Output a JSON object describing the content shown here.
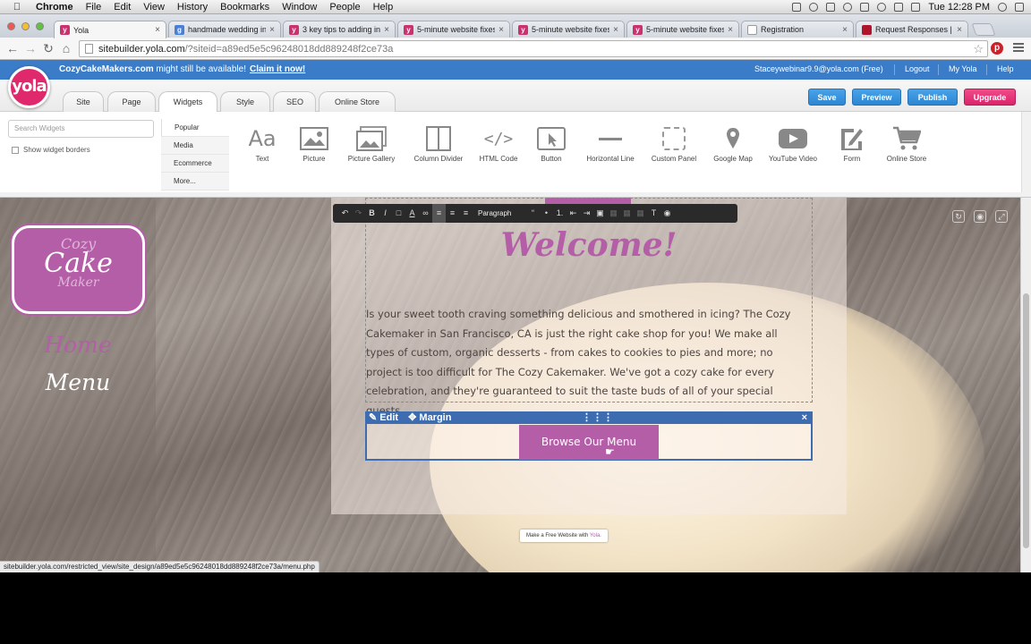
{
  "macos": {
    "menu": [
      "Chrome",
      "File",
      "Edit",
      "View",
      "History",
      "Bookmarks",
      "Window",
      "People",
      "Help"
    ],
    "clock": "Tue 12:28 PM"
  },
  "browser": {
    "tabs": [
      {
        "title": "Yola",
        "fav": "y"
      },
      {
        "title": "handmade wedding in...",
        "fav": "g"
      },
      {
        "title": "3 key tips to adding in...",
        "fav": "y"
      },
      {
        "title": "5-minute website fixes...",
        "fav": "y"
      },
      {
        "title": "5-minute website fixes...",
        "fav": "y"
      },
      {
        "title": "5-minute website fixes...",
        "fav": "y"
      },
      {
        "title": "Registration",
        "fav": "d"
      },
      {
        "title": "Request Responses | H...",
        "fav": "r"
      }
    ],
    "url_host": "sitebuilder.yola.com",
    "url_rest": "/?siteid=a89ed5e5c96248018dd889248f2ce73a",
    "status_url": "sitebuilder.yola.com/restricted_view/site_design/a89ed5e5c96248018dd889248f2ce73a/menu.php"
  },
  "yola": {
    "logo_text": "yola",
    "domain_msg": {
      "domain": "CozyCakeMakers.com",
      "text": " might still be available!",
      "claim": "Claim it now!"
    },
    "account": {
      "email": "Staceywebinar9.9@yola.com (Free)",
      "logout": "Logout",
      "my_yola": "My Yola",
      "help": "Help"
    },
    "nav_tabs": [
      "Site",
      "Page",
      "Widgets",
      "Style",
      "SEO",
      "Online Store"
    ],
    "actions": {
      "save": "Save",
      "preview": "Preview",
      "publish": "Publish",
      "upgrade": "Upgrade"
    },
    "widgets": {
      "search_placeholder": "Search Widgets",
      "show_borders": "Show widget borders",
      "categories": [
        "Popular",
        "Media",
        "Ecommerce",
        "More..."
      ],
      "items": [
        {
          "label": "Text",
          "icon": "text-icon"
        },
        {
          "label": "Picture",
          "icon": "picture-icon"
        },
        {
          "label": "Picture Gallery",
          "icon": "picture-gallery-icon"
        },
        {
          "label": "Column Divider",
          "icon": "column-divider-icon"
        },
        {
          "label": "HTML Code",
          "icon": "html-code-icon"
        },
        {
          "label": "Button",
          "icon": "button-icon"
        },
        {
          "label": "Horizontal Line",
          "icon": "horizontal-line-icon"
        },
        {
          "label": "Custom Panel",
          "icon": "custom-panel-icon"
        },
        {
          "label": "Google Map",
          "icon": "map-pin-icon"
        },
        {
          "label": "YouTube Video",
          "icon": "youtube-icon"
        },
        {
          "label": "Form",
          "icon": "form-icon"
        },
        {
          "label": "Online Store",
          "icon": "cart-icon"
        }
      ]
    }
  },
  "site": {
    "logo": {
      "l1": "Cozy",
      "l2": "Cake",
      "l3": "Maker"
    },
    "nav": [
      {
        "label": "Home",
        "color": "#b55ea8"
      },
      {
        "label": "Menu",
        "color": "#ffffff"
      }
    ],
    "heading": "Welcome!",
    "body": "Is your sweet tooth craving something delicious and smothered in icing? The Cozy Cakemaker in San Francisco, CA is just the right cake shop for you! We make all types of custom, organic desserts - from cakes to cookies to pies and more; no project is too difficult for The Cozy Cakemaker. We've got a cozy cake for every celebration, and they're guaranteed to suit the taste buds of all of your special guests.",
    "editor": {
      "paragraph": "Paragraph"
    },
    "edit_bar": {
      "edit": "Edit",
      "margin": "Margin",
      "close": "×"
    },
    "button_label": "Browse Our Menu",
    "free_badge": {
      "text": "Make a Free Website with ",
      "brand": "Yola."
    },
    "accent": "#b55ea8"
  }
}
